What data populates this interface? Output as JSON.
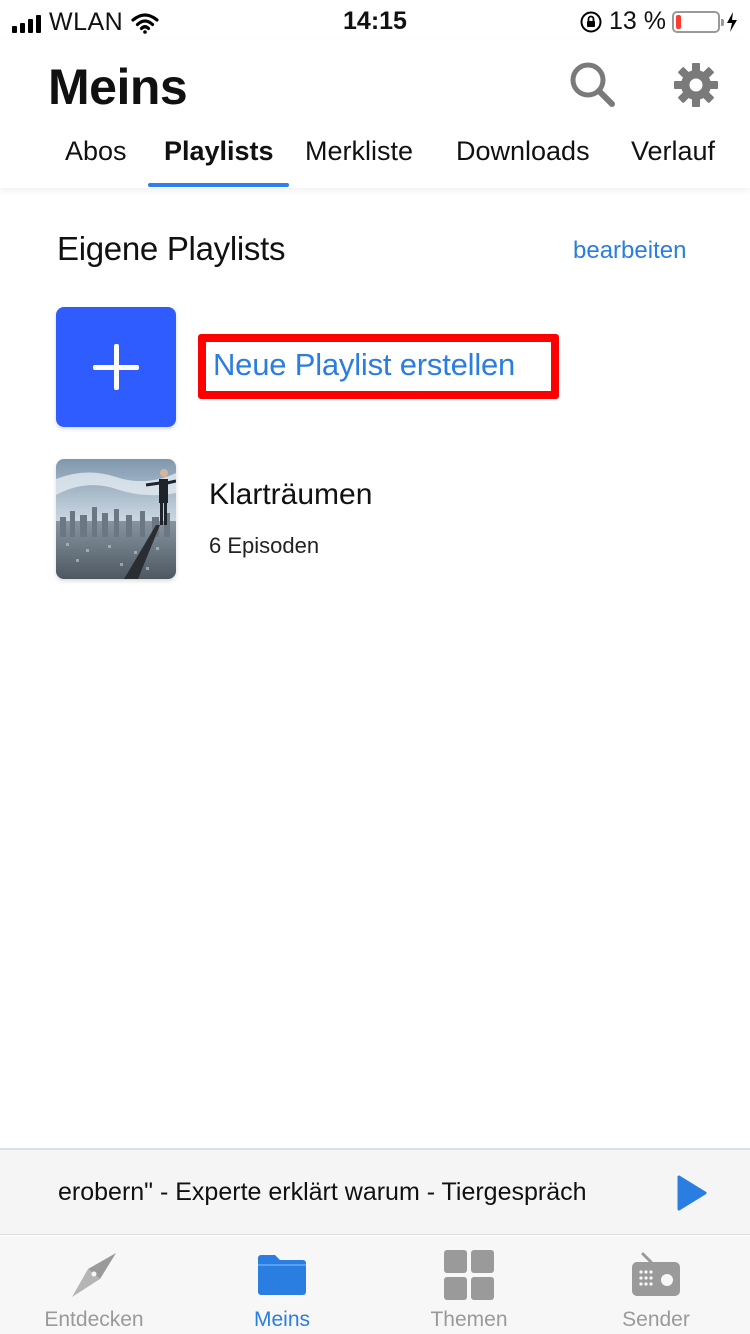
{
  "status_bar": {
    "carrier": "WLAN",
    "time": "14:15",
    "battery_percent": "13 %",
    "battery_level": 0.13
  },
  "header": {
    "title": "Meins",
    "tabs": [
      {
        "label": "Abos",
        "active": false
      },
      {
        "label": "Playlists",
        "active": true
      },
      {
        "label": "Merkliste",
        "active": false
      },
      {
        "label": "Downloads",
        "active": false
      },
      {
        "label": "Verlauf",
        "active": false
      }
    ]
  },
  "section": {
    "title": "Eigene Playlists",
    "edit_label": "bearbeiten"
  },
  "new_playlist": {
    "label": "Neue Playlist erstellen"
  },
  "playlists": [
    {
      "title": "Klarträumen",
      "subtitle": "6 Episoden"
    }
  ],
  "mini_player": {
    "text": "erobern\" - Experte erklärt warum - Tiergespräch"
  },
  "tabbar": {
    "items": [
      {
        "label": "Entdecken",
        "icon": "compass-icon",
        "active": false
      },
      {
        "label": "Meins",
        "icon": "folder-icon",
        "active": true
      },
      {
        "label": "Themen",
        "icon": "grid-icon",
        "active": false
      },
      {
        "label": "Sender",
        "icon": "radio-icon",
        "active": false
      }
    ]
  },
  "colors": {
    "accent": "#2a7de1",
    "tile_blue": "#2f5cff",
    "highlight_red": "#ff0000",
    "battery_red": "#ff3b30"
  }
}
